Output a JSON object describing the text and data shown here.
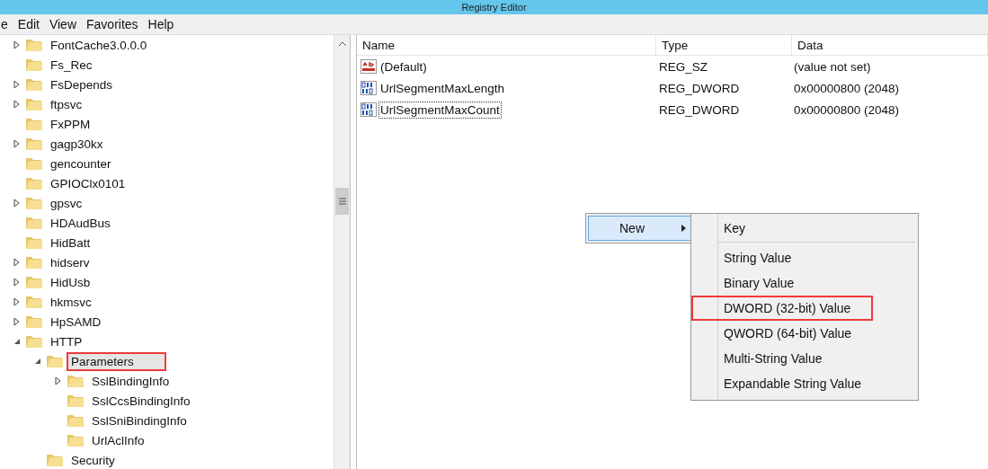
{
  "window": {
    "title": "Registry Editor"
  },
  "menu": [
    "e",
    "Edit",
    "View",
    "Favorites",
    "Help"
  ],
  "tree": [
    {
      "label": "FontCache3.0.0.0",
      "expanded": false,
      "selected": false,
      "highlighted": false
    },
    {
      "label": "Fs_Rec",
      "selected": false,
      "highlighted": false
    },
    {
      "label": "FsDepends",
      "expanded": false,
      "selected": false,
      "highlighted": false
    },
    {
      "label": "ftpsvc",
      "expanded": false,
      "selected": false,
      "highlighted": false
    },
    {
      "label": "FxPPM",
      "selected": false,
      "highlighted": false
    },
    {
      "label": "gagp30kx",
      "expanded": false,
      "selected": false,
      "highlighted": false
    },
    {
      "label": "gencounter",
      "selected": false,
      "highlighted": false
    },
    {
      "label": "GPIOClx0101",
      "selected": false,
      "highlighted": false
    },
    {
      "label": "gpsvc",
      "expanded": false,
      "selected": false,
      "highlighted": false
    },
    {
      "label": "HDAudBus",
      "selected": false,
      "highlighted": false
    },
    {
      "label": "HidBatt",
      "selected": false,
      "highlighted": false
    },
    {
      "label": "hidserv",
      "expanded": false,
      "selected": false,
      "highlighted": false
    },
    {
      "label": "HidUsb",
      "expanded": false,
      "selected": false,
      "highlighted": false
    },
    {
      "label": "hkmsvc",
      "expanded": false,
      "selected": false,
      "highlighted": false
    },
    {
      "label": "HpSAMD",
      "expanded": false,
      "selected": false,
      "highlighted": false
    },
    {
      "label": "HTTP",
      "expanded": true,
      "selected": false,
      "highlighted": false,
      "children": [
        {
          "label": "Parameters",
          "expanded": true,
          "selected": true,
          "highlighted": true,
          "children": [
            {
              "label": "SslBindingInfo",
              "expanded": false,
              "selected": false,
              "highlighted": false
            },
            {
              "label": "SslCcsBindingInfo",
              "selected": false,
              "highlighted": false
            },
            {
              "label": "SslSniBindingInfo",
              "selected": false,
              "highlighted": false
            },
            {
              "label": "UrlAclInfo",
              "selected": false,
              "highlighted": false
            }
          ]
        },
        {
          "label": "Security",
          "selected": false,
          "highlighted": false
        }
      ]
    }
  ],
  "values": {
    "columns": [
      "Name",
      "Type",
      "Data"
    ],
    "rows": [
      {
        "kind": "string",
        "name": "(Default)",
        "type": "REG_SZ",
        "data": "(value not set)",
        "selected": false
      },
      {
        "kind": "binary",
        "name": "UrlSegmentMaxLength",
        "type": "REG_DWORD",
        "data": "0x00000800 (2048)",
        "selected": false
      },
      {
        "kind": "binary",
        "name": "UrlSegmentMaxCount",
        "type": "REG_DWORD",
        "data": "0x00000800 (2048)",
        "selected": true
      }
    ]
  },
  "context_menu": {
    "items": [
      {
        "label": "New",
        "selected": true,
        "submenu": true
      }
    ]
  },
  "submenu": {
    "items": [
      {
        "label": "Key",
        "highlighted": false,
        "separator_after": true
      },
      {
        "label": "String Value",
        "highlighted": false,
        "separator_after": false
      },
      {
        "label": "Binary Value",
        "highlighted": false,
        "separator_after": false
      },
      {
        "label": "DWORD (32-bit) Value",
        "highlighted": true,
        "separator_after": false
      },
      {
        "label": "QWORD (64-bit) Value",
        "highlighted": false,
        "separator_after": false
      },
      {
        "label": "Multi-String Value",
        "highlighted": false,
        "separator_after": false
      },
      {
        "label": "Expandable String Value",
        "highlighted": false,
        "separator_after": false
      }
    ]
  }
}
